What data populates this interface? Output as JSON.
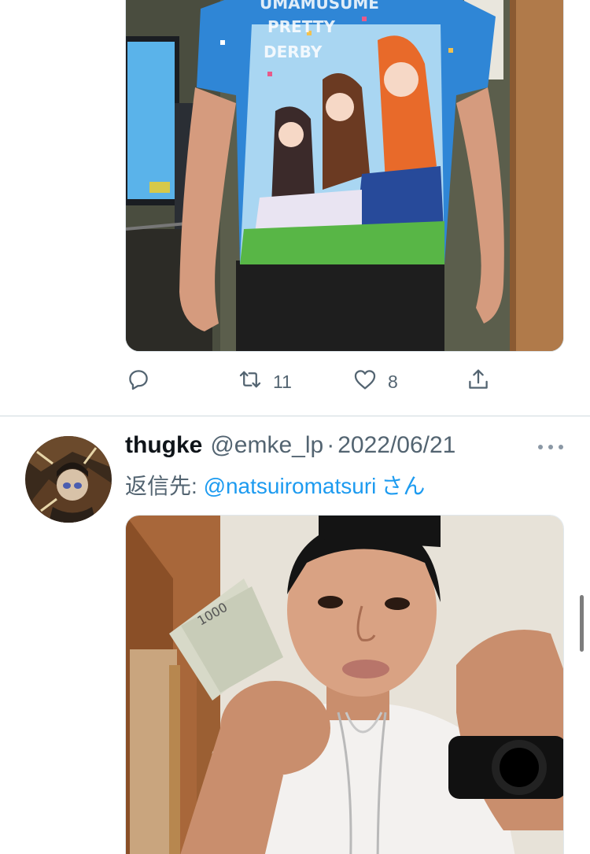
{
  "tweet_1": {
    "actions": {
      "reply_icon": "reply-icon",
      "retweet_icon": "retweet-icon",
      "retweet_count": "11",
      "like_icon": "heart-icon",
      "like_count": "8",
      "share_icon": "share-icon"
    },
    "media": {
      "shirt_text": "UMAMUSUME PRETTY DERBY"
    }
  },
  "tweet_2": {
    "display_name": "thugke",
    "handle": "@emke_lp",
    "separator": "·",
    "date": "2022/06/21",
    "reply_prefix": "返信先: ",
    "reply_mention": "@natsuiromatsuri",
    "reply_suffix": "さん",
    "more_icon": "more-horizontal-icon"
  },
  "colors": {
    "accent": "#1d9bf0",
    "secondary_text": "#536471",
    "divider": "#cfd9de"
  }
}
